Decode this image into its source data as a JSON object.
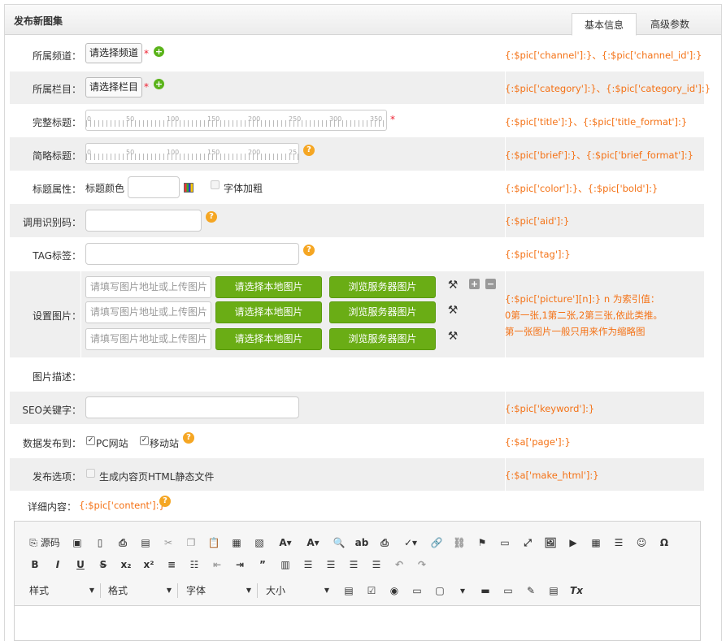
{
  "header": {
    "title": "发布新图集",
    "tabs": [
      "基本信息",
      "高级参数"
    ]
  },
  "rows": {
    "channel": {
      "label": "所属频道：",
      "button": "请选择频道",
      "required": "*",
      "hint": "{:$pic['channel']:}、{:$pic['channel_id']:}"
    },
    "category": {
      "label": "所属栏目：",
      "button": "请选择栏目",
      "required": "*",
      "hint": "{:$pic['category']:}、{:$pic['category_id']:}"
    },
    "title": {
      "label": "完整标题：",
      "required": "*",
      "hint": "{:$pic['title']:}、{:$pic['title_format']:}",
      "ticks": [
        "0",
        "50",
        "100",
        "150",
        "200",
        "250",
        "300",
        "350"
      ]
    },
    "brief": {
      "label": "简略标题：",
      "hint": "{:$pic['brief']:}、{:$pic['brief_format']:}",
      "ticks": [
        "0",
        "50",
        "100",
        "150",
        "200",
        "25"
      ]
    },
    "attr": {
      "label": "标题属性：",
      "color_label": "标题颜色",
      "bold_label": "字体加粗",
      "hint": "{:$pic['color']:}、{:$pic['bold']:}"
    },
    "aid": {
      "label": "调用识别码：",
      "hint": "{:$pic['aid']:}"
    },
    "tag": {
      "label": "TAG标签：",
      "hint": "{:$pic['tag']:}"
    },
    "pictures": {
      "label": "设置图片：",
      "placeholder": "请填写图片地址或上传图片",
      "local_button": "请选择本地图片",
      "server_button": "浏览服务器图片",
      "hint_lines": [
        "{:$pic['picture'][n]:} n 为索引值：",
        "0第一张,1第二张,2第三张,依此类推。",
        "第一张图片一般只用来作为缩略图"
      ]
    },
    "desc": {
      "label": "图片描述："
    },
    "keyword": {
      "label": "SEO关键字：",
      "hint": "{:$pic['keyword']:}"
    },
    "publish": {
      "label": "数据发布到：",
      "pc_label": "PC网站",
      "mobile_label": "移动站",
      "hint": "{:$a['page']:}"
    },
    "options": {
      "label": "发布选项：",
      "html_label": "生成内容页HTML静态文件",
      "hint": "{:$a['make_html']:}"
    },
    "content": {
      "label": "详细内容：",
      "hint": "{:$pic['content']:}"
    }
  },
  "editor": {
    "source_label": "源码",
    "style_dd": "样式",
    "format_dd": "格式",
    "font_dd": "字体",
    "size_dd": "大小"
  }
}
